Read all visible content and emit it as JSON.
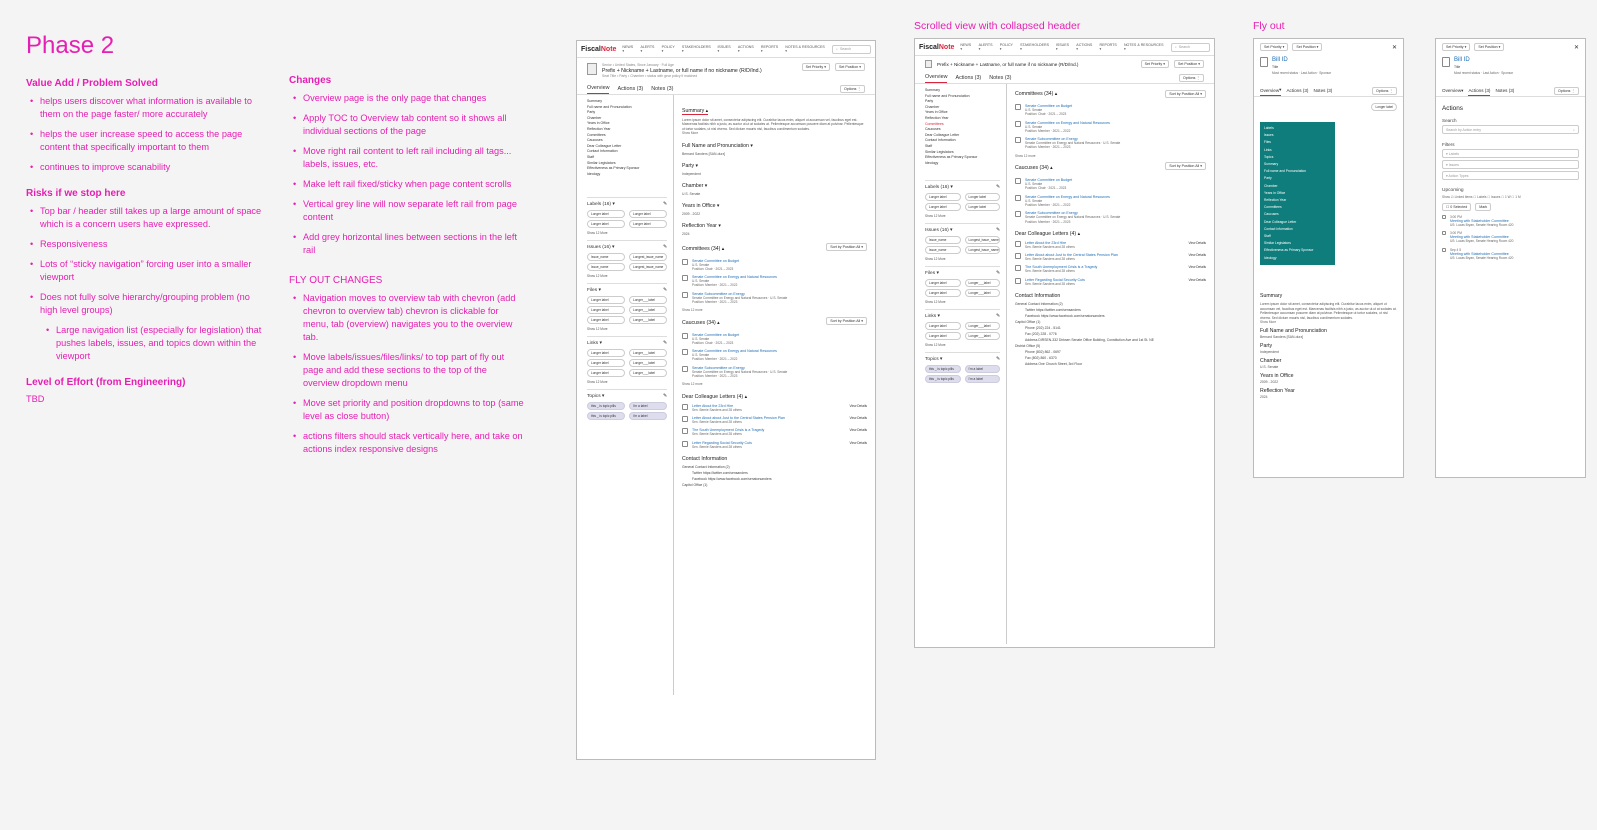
{
  "notes": {
    "title": "Phase 2",
    "value_heading": "Value Add / Problem Solved",
    "value_items": [
      "helps users discover what information is available to them on the page faster/ more accurately",
      "helps the user increase speed to access the page content that specifically important to them",
      "continues to improve scanability"
    ],
    "risks_heading": "Risks if we stop here",
    "risk_items": [
      "Top bar / header still takes up a large amount of space which is a concern users have expressed.",
      "Responsiveness",
      "Lots of “sticky navigation” forcing user into a smaller viewport",
      "Does not fully solve hierarchy/grouping problem (no high level groups)"
    ],
    "risk_subitem": "Large navigation list (especially for legislation) that pushes labels, issues, and topics down within the viewport",
    "effort_heading": "Level of Effort (from Engineering)",
    "effort_value": "TBD",
    "changes_heading": "Changes",
    "change_items": [
      "Overview page is the only page that changes",
      "Apply TOC to Overview tab content so it shows all individual sections of the page",
      "Move right rail content to left rail including all tags... labels, issues, etc.",
      "Make left rail fixed/sticky when page content scrolls",
      "Vertical grey line will now separate left rail from page content",
      "Add grey horizontal lines between sections in the left rail"
    ],
    "flyout_heading": "FLY OUT CHANGES",
    "flyout_items": [
      "Navigation moves to overview tab with chevron (add chevron to overview tab) chevron is clickable for menu, tab (overview) navigates you to the overview tab.",
      "Move labels/issues/files/links/ to top part of fly out page and add these sections to the top of the overview dropdown menu",
      "Move set priority and position dropdowns to top (same level as close button)",
      "actions filters should stack vertically here, and take on actions index responsive designs"
    ]
  },
  "captions": {
    "scrolled": "Scrolled view with collapsed header",
    "flyout": "Fly out"
  },
  "app": {
    "logo_a": "Fiscal",
    "logo_b": "Note",
    "nav": [
      "NEWS ▾",
      "ALERTS ▾",
      "POLICY ▾",
      "STAKEHOLDERS ▾",
      "ISSUES ▾",
      "ACTIONS ▾",
      "REPORTS ▾",
      "NOTES & RESOURCES ▾"
    ],
    "search": "Search",
    "person": "Prefix + Nickname + Lastname, or full name if no nickname (R/D/Ind.)",
    "person_meta": "Senior • United States, Since January · Full Age",
    "person_sub": "Seat Title • Party • Chamber • status with gear policy if matched",
    "set_priority": "Set Priority ▾",
    "set_position": "Set Position ▾",
    "tabs": [
      "Overview",
      "Actions (3)",
      "Notes (3)"
    ],
    "options": "Options ⋮",
    "toc": [
      "Summary",
      "Full name and Pronunciation",
      "Party",
      "Chamber",
      "Years in Office",
      "Reflection Year",
      "Committees",
      "Caucuses",
      "Dear Colleague Letter",
      "Contact Information",
      "Staff",
      "Similar Legislators",
      "Effectiveness as Primary Sponsor",
      "Ideology"
    ],
    "labels_h": "Labels (16) ▾",
    "issues_h": "Issues (16) ▾",
    "files_h": "Files ▾",
    "links_h": "Links ▾",
    "topics_h": "Topics ▾",
    "label_chip": "Longer label",
    "issue_chip": "Issue_name",
    "issue_chip2": "Longest_issue_name",
    "file_chip": "Longer___label",
    "topic_chip": "this _ is topic pills",
    "topic_chip2": "I'm a label",
    "show_more": "Show 12 More",
    "summary_h": "Summary ▴",
    "summary_text": "Lorem ipsum dolor sit amet, consectetur adipiscing elit. Curabitur lacus enim, aliquet ut accumsan vel, faucibus eget est. Maecenas facilisis nibh a justo, as auctor ut.ut at sodales at. Pellentesque accumsan posuere diam at pulvinar. Pellentesque ut tortor sodales, ut nisl viverra. Sed dictum mauris nisl, faucibus condimentum sodales.",
    "show_more_2": "Show More",
    "fullname_h": "Full Name and Pronunciation ▾",
    "fullname_v": "Bernard Sanders [SAN-durz]",
    "party_h": "Party ▾",
    "party_v": "Independent",
    "chamber_h": "Chamber ▾",
    "chamber_v": "U.S. Senate",
    "years_h": "Years in Office ▾",
    "years_v": "2009 - 2022",
    "refl_h": "Reflection Year ▾",
    "refl_v": "2024",
    "committees_h": "Committees (34) ▴",
    "caucuses_h": "Caucuses (34) ▴",
    "sort": "Sort by Position",
    "sort_v": "All ▾",
    "committees": [
      {
        "name": "Senate Committee on Budget",
        "sub": "U.S. Senate",
        "pos": "Position: Chair · 2021 – 2023"
      },
      {
        "name": "Senate Committee on Energy and Natural Resources",
        "sub": "U.S. Senate",
        "pos": "Position: Member · 2021 – 2022"
      },
      {
        "name": "Senate Subcommittee on Energy",
        "sub": "Senate Committee on Energy and Natural Resources · U.S. Senate",
        "pos": "Position: Member · 2021 – 2023"
      }
    ],
    "show_more_3": "Show 12 more",
    "dcl_h": "Dear Colleague Letters (4) ▴",
    "letters": [
      {
        "name": "Letter About the 23rd Hire",
        "sub": "Sen. Bernie Sanders and 28 others"
      },
      {
        "name": "Letter About about Just to the Central States Pension Plan",
        "sub": "Sen. Bernie Sanders and 28 others"
      },
      {
        "name": "The South Unemployment Crisis is a Tragedy",
        "sub": "Sen. Bernie Sanders and 28 others"
      },
      {
        "name": "Letter Regarding Social Security Cuts",
        "sub": "Sen. Bernie Sanders and 28 others"
      }
    ],
    "view_details": "View Details",
    "contact_h": "Contact Information",
    "gci": "General Contact Information (2)",
    "twitter": "Twitter  https://twitter.com/sensanders",
    "facebook": "Facebook  https://www.facebook.com/senatorsanders",
    "capitol": "Capitol Office (1)",
    "phone": "Phone  (202) 224 - 5141",
    "fax": "Fax  (202) 228 - 0776",
    "address": "Address  DIRSEN-332 Dirksen Senate Office Building, Constitution Ave and 1st St. NE",
    "district": "District Office (5)",
    "dphone": "Phone  (802) 862 - 0697",
    "dfax": "Fax  (802) 860 - 6370",
    "daddr": "Address  One Church Street, 3rd Floor"
  },
  "flyout": {
    "bill_id": "Bill ID",
    "title": "Title",
    "sub": "Most recent status · Last Action · Sponsor",
    "menu": [
      "Labels",
      "Issues",
      "Files",
      "Links",
      "Topics",
      "Summary",
      "Full name and Pronunciation",
      "Party",
      "Chamber",
      "Years in Office",
      "Reflection Year",
      "Committees",
      "Caucuses",
      "Dear Colleague Letter",
      "Contact Information",
      "Staff",
      "Similar Legislators",
      "Effectiveness as Primary Sponsor",
      "Ideology"
    ],
    "actions_h": "Actions",
    "search_h": "Search",
    "search_ph": "Search by Action entry",
    "filters_h": "Filters",
    "filters": [
      "▾ Labels",
      "▾ Issues",
      "▾ Action Types"
    ],
    "upcoming_h": "Upcoming",
    "show": "Show  ☑ Linked items  ☐ Labels  ☐ Issues  ☐ 1 W  ☐ 1 M",
    "selected": "☐ 0 Selected",
    "mark": "Mark",
    "events": [
      {
        "time": "3:00 PM",
        "name": "Meeting with Stakeholder Committee",
        "sub": "US: Lucas Bryan, Senate Hearing Room 420"
      },
      {
        "time": "3:00 PM",
        "name": "Meeting with Stakeholder Committee",
        "sub": "US: Lucas Bryan, Senate Hearing Room 420"
      },
      {
        "time": "Sep 4 5",
        "name": "Meeting with Stakeholder Committee",
        "sub": "US: Lucas Bryan, Senate Hearing Room 420"
      }
    ],
    "summary_h": "Summary",
    "fullname": "Full Name and Pronunciation",
    "fullname_v": "Bernard Sanders [SAN-durz]",
    "party": "Party",
    "party_v": "Independent",
    "chamber": "Chamber",
    "chamber_v": "U.S. Senate",
    "years": "Years in Office",
    "years_v": "2009 - 2022",
    "refl": "Reflection Year",
    "refl_v": "2024",
    "close": "✕"
  }
}
